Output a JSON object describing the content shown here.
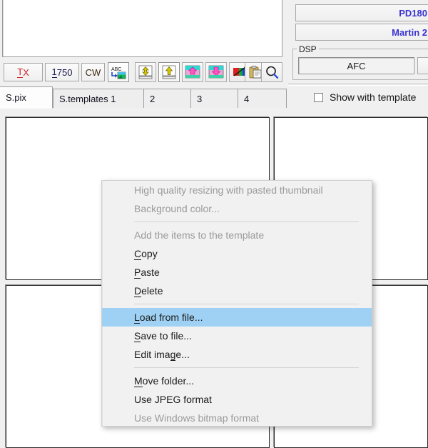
{
  "app": {
    "rx_panel": {
      "name": "receive-image-panel",
      "content": ""
    }
  },
  "toolbar": {
    "tx_label": "TX",
    "tx_accel": "T",
    "tx_rest": "X",
    "freq_label": "1750",
    "freq_accel": "1",
    "freq_rest": "750",
    "mode_label": "CW",
    "icons": [
      {
        "name": "abc-to-image-icon",
        "title": "ABC",
        "selected": true
      },
      {
        "name": "move-up-down-icon",
        "title": "",
        "selected": false
      },
      {
        "name": "move-up-icon",
        "title": "",
        "selected": true
      },
      {
        "name": "image-shift-up-icon",
        "title": "",
        "selected": false
      },
      {
        "name": "image-shift-down-icon",
        "title": "",
        "selected": false
      },
      {
        "name": "color-adjust-icon",
        "title": "",
        "selected": false
      },
      {
        "name": "paste-clipboard-icon",
        "title": "",
        "selected": false
      },
      {
        "name": "magnifier-icon",
        "title": "",
        "selected": false
      }
    ]
  },
  "tabs": [
    {
      "label": "S.pix",
      "active": true
    },
    {
      "label": "S.templates 1",
      "active": false
    },
    {
      "label": "2",
      "active": false
    },
    {
      "label": "3",
      "active": false
    },
    {
      "label": "4",
      "active": false
    }
  ],
  "right_panel": {
    "fields": [
      {
        "name": "mode-field-pd180",
        "value": "PD180"
      },
      {
        "name": "mode-field-martin",
        "value": "Martin 2"
      }
    ],
    "dsp": {
      "group_label": "DSP",
      "afc_label": "AFC"
    },
    "checkbox": {
      "label": "Show with template",
      "checked": false
    }
  },
  "context_menu": {
    "items": [
      {
        "label": "High quality resizing with pasted thumbnail",
        "accel": "",
        "disabled": true,
        "highlight": false,
        "separator_after": false
      },
      {
        "label": "Background color...",
        "accel": "",
        "disabled": true,
        "highlight": false,
        "separator_after": true
      },
      {
        "label": "Add the items to the template",
        "accel": "",
        "disabled": true,
        "highlight": false,
        "separator_after": false
      },
      {
        "label": "Copy",
        "accel": "C",
        "disabled": false,
        "highlight": false,
        "separator_after": false
      },
      {
        "label": "Paste",
        "accel": "P",
        "disabled": false,
        "highlight": false,
        "separator_after": false
      },
      {
        "label": "Delete",
        "accel": "D",
        "disabled": false,
        "highlight": false,
        "separator_after": true
      },
      {
        "label": "Load from file...",
        "accel": "L",
        "disabled": false,
        "highlight": true,
        "separator_after": false
      },
      {
        "label": "Save to file...",
        "accel": "S",
        "disabled": false,
        "highlight": false,
        "separator_after": false
      },
      {
        "label": "Edit image...",
        "accel": "g",
        "disabled": false,
        "highlight": false,
        "separator_after": true
      },
      {
        "label": "Move folder...",
        "accel": "M",
        "disabled": false,
        "highlight": false,
        "separator_after": false
      },
      {
        "label": "Use JPEG format",
        "accel": "",
        "disabled": false,
        "highlight": false,
        "separator_after": false
      },
      {
        "label": "Use Windows bitmap format",
        "accel": "",
        "disabled": true,
        "highlight": false,
        "separator_after": false
      }
    ]
  },
  "colors": {
    "highlight": "#9fd1f4",
    "menu_bg": "#f1f1f1",
    "disabled_text": "#9a9a9a",
    "field_text": "#3a33cf",
    "tx_red": "#d02020",
    "window_bg": "#f0f0f0"
  }
}
